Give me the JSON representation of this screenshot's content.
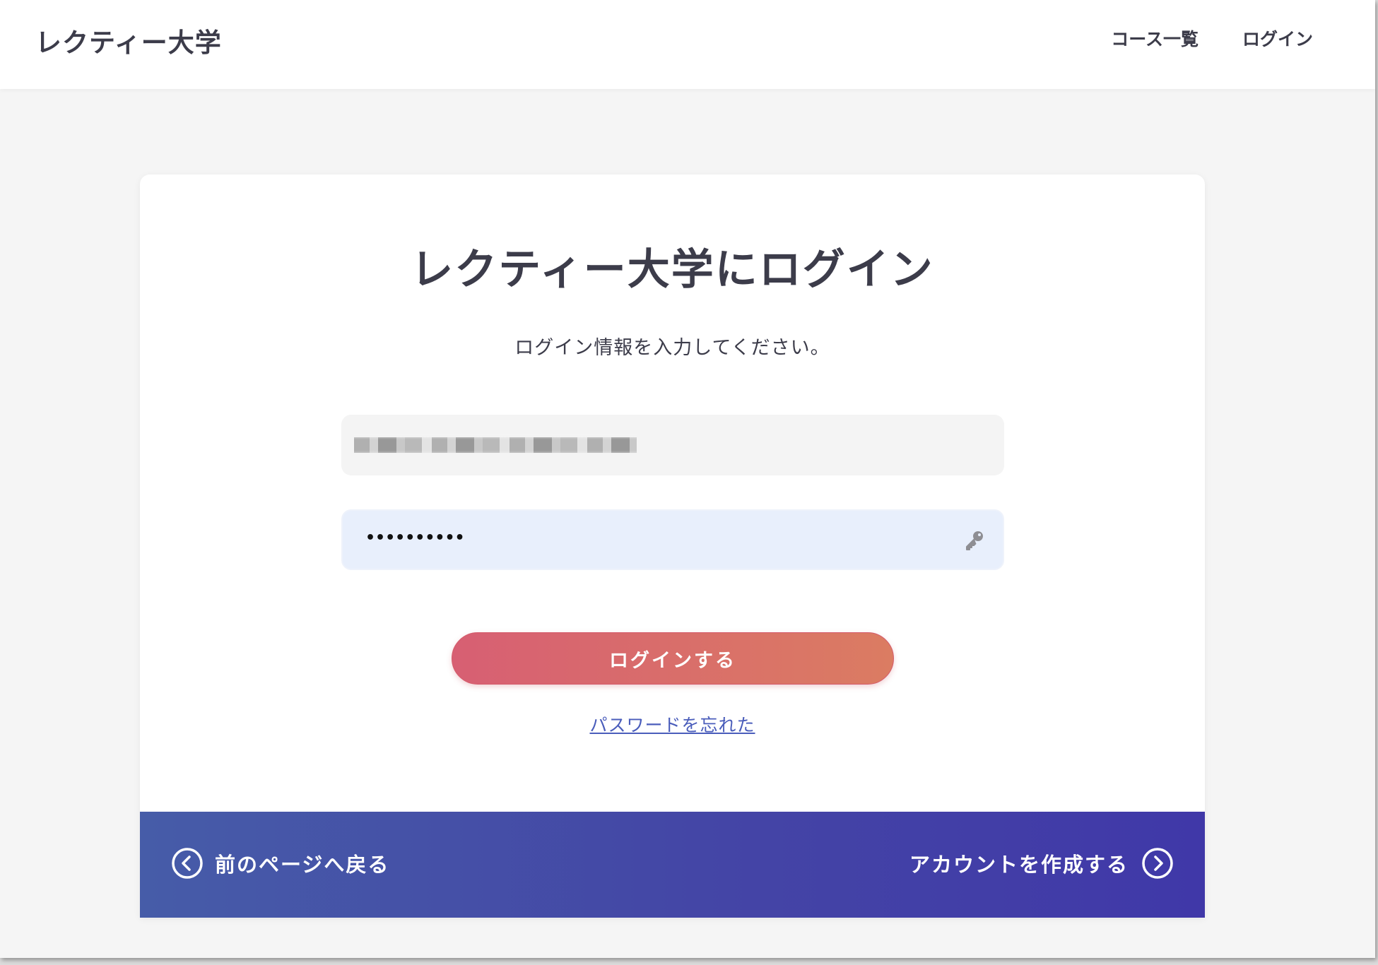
{
  "header": {
    "site_title": "レクティー大学",
    "nav": [
      {
        "label": "コース一覧"
      },
      {
        "label": "ログイン"
      }
    ]
  },
  "login_card": {
    "title": "レクティー大学にログイン",
    "subtitle": "ログイン情報を入力してください。",
    "email": {
      "value_note": "pixelated"
    },
    "password": {
      "masked_value": "••••••••••",
      "icon": "key-icon"
    },
    "submit_label": "ログインする",
    "forgot_label": "パスワードを忘れた"
  },
  "footer": {
    "back_label": "前のページへ戻る",
    "back_icon": "chevron-left-circle-icon",
    "create_label": "アカウントを作成する",
    "create_icon": "chevron-right-circle-icon"
  },
  "colors": {
    "page_background": "#f5f5f5",
    "text": "#3c3c4a",
    "button_gradient_start": "#d75f73",
    "button_gradient_end": "#db7c62",
    "link": "#4a5dbb",
    "footer_gradient_start": "#465ca8",
    "footer_gradient_end": "#4038a8",
    "password_field_background": "#e8effc"
  }
}
